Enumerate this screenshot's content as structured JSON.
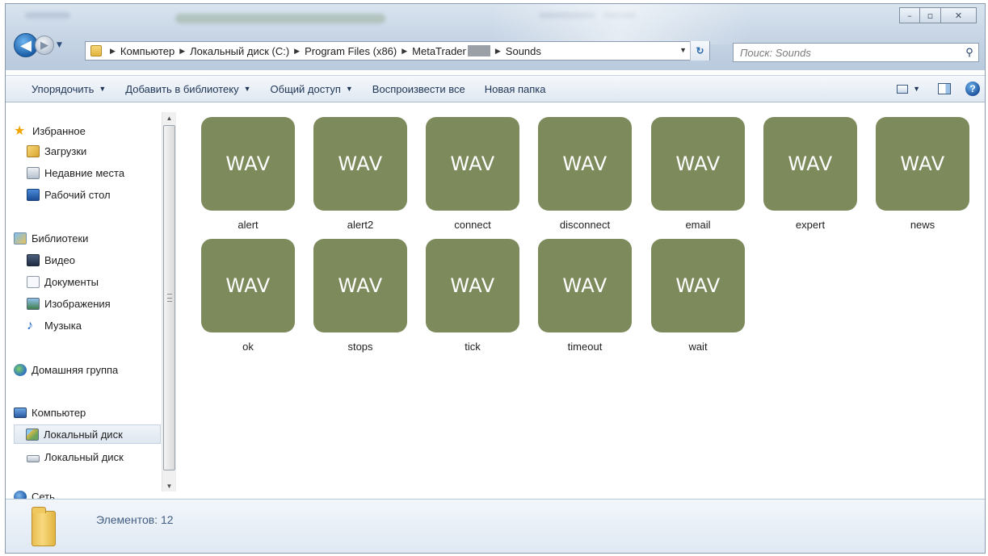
{
  "window": {
    "caption_minimize": "–",
    "caption_maximize": "▫",
    "caption_close": "✕"
  },
  "nav": {
    "back_glyph": "◀",
    "forward_glyph": "▶",
    "history_glyph": "▼"
  },
  "address": {
    "crumbs": [
      "Компьютер",
      "Локальный диск (C:)",
      "Program Files (x86)",
      "MetaTrader",
      "Sounds"
    ],
    "separator": "▶",
    "dropdown_glyph": "▼",
    "refresh_glyph": "↻"
  },
  "search": {
    "placeholder": "Поиск: Sounds",
    "icon": "search-icon"
  },
  "toolbar": {
    "items": [
      {
        "label": "Упорядочить",
        "has_arrow": true
      },
      {
        "label": "Добавить в библиотеку",
        "has_arrow": true
      },
      {
        "label": "Общий доступ",
        "has_arrow": true
      },
      {
        "label": "Воспроизвести все",
        "has_arrow": false
      },
      {
        "label": "Новая папка",
        "has_arrow": false
      }
    ],
    "arrow_glyph": "▼",
    "help_label": "?"
  },
  "sidebar": {
    "items": [
      {
        "label": "Избранное",
        "icon": "star-icon"
      },
      {
        "label": "Загрузки",
        "icon": "downloads-folder-icon"
      },
      {
        "label": "Недавние места",
        "icon": "recent-places-icon"
      },
      {
        "label": "Рабочий стол",
        "icon": "desktop-icon"
      },
      {
        "label": "Библиотеки",
        "icon": "libraries-icon"
      },
      {
        "label": "Видео",
        "icon": "video-library-icon"
      },
      {
        "label": "Документы",
        "icon": "documents-library-icon"
      },
      {
        "label": "Изображения",
        "icon": "pictures-library-icon"
      },
      {
        "label": "Музыка",
        "icon": "music-library-icon"
      },
      {
        "label": "Домашняя группа",
        "icon": "homegroup-icon"
      },
      {
        "label": "Компьютер",
        "icon": "computer-icon"
      },
      {
        "label": "Локальный диск",
        "icon": "system-drive-icon",
        "selected": true
      },
      {
        "label": "Локальный диск",
        "icon": "drive-icon"
      },
      {
        "label": "Сеть",
        "icon": "network-icon"
      }
    ],
    "scroll_up_glyph": "▲",
    "scroll_down_glyph": "▼"
  },
  "files": {
    "type_label": "WAV",
    "tile_color": "#7d8b5c",
    "items": [
      "alert",
      "alert2",
      "connect",
      "disconnect",
      "email",
      "expert",
      "news",
      "ok",
      "stops",
      "tick",
      "timeout",
      "wait"
    ]
  },
  "status": {
    "count_text": "Элементов: 12"
  }
}
